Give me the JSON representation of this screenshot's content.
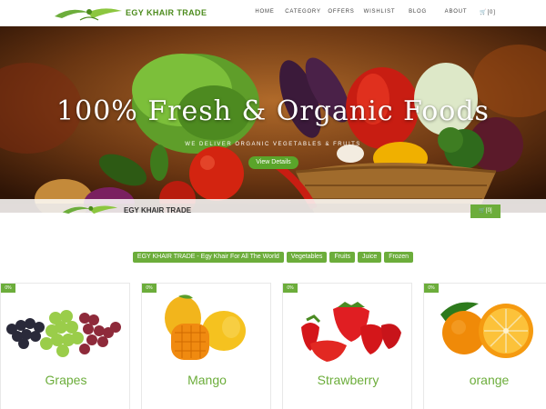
{
  "header": {
    "brand": "EGY KHAIR TRADE",
    "nav": [
      "HOME",
      "CATEGORY",
      "OFFERS",
      "WISHLIST",
      "BLOG",
      "ABOUT"
    ],
    "cart": "[0]"
  },
  "hero": {
    "title": "100% Fresh & Organic Foods",
    "subtitle": "WE DELIVER ORGANIC VEGETABLES & FRUITS",
    "button": "View Details"
  },
  "sticky_header": {
    "brand": "EGY KHAIR TRADE",
    "cart": "[0]"
  },
  "categories": [
    "EGY KHAIR TRADE - Egy Khair For All The World",
    "Vegetables",
    "Fruits",
    "Juice",
    "Frozen"
  ],
  "products": [
    {
      "name": "Grapes",
      "badge": "0%"
    },
    {
      "name": "Mango",
      "badge": "0%"
    },
    {
      "name": "Strawberry",
      "badge": "0%"
    },
    {
      "name": "orange",
      "badge": "0%"
    }
  ],
  "colors": {
    "accent": "#6cad3b",
    "brand_text": "#4c8b1d"
  }
}
